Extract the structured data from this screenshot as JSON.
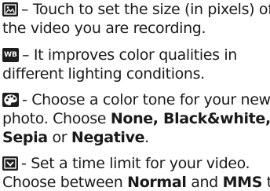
{
  "items": [
    {
      "icon": "video-size-icon",
      "line1": "– Touch to set the size (in pixels) of",
      "line2": "the video you are recording."
    },
    {
      "icon": "white-balance-icon",
      "icon_text": "WB",
      "line1": "– It improves color qualities in",
      "line2": "different lighting conditions."
    },
    {
      "icon": "color-effect-palette-icon",
      "line1": "- Choose a color tone for your new",
      "line2_pre": "photo. Choose ",
      "opt_none": "None, ",
      "opt_bw": "Black&white,",
      "line3_sepia": "Sepia",
      "line3_or": " or ",
      "line3_negative": "Negative",
      "line3_end": "."
    },
    {
      "icon": "duration-icon",
      "line1": "- Set a time limit for your video.",
      "line2_pre": "Choose between ",
      "opt_normal": "Normal",
      "line2_and": " and ",
      "opt_mms": "MMS",
      "line2_end": " to"
    }
  ]
}
